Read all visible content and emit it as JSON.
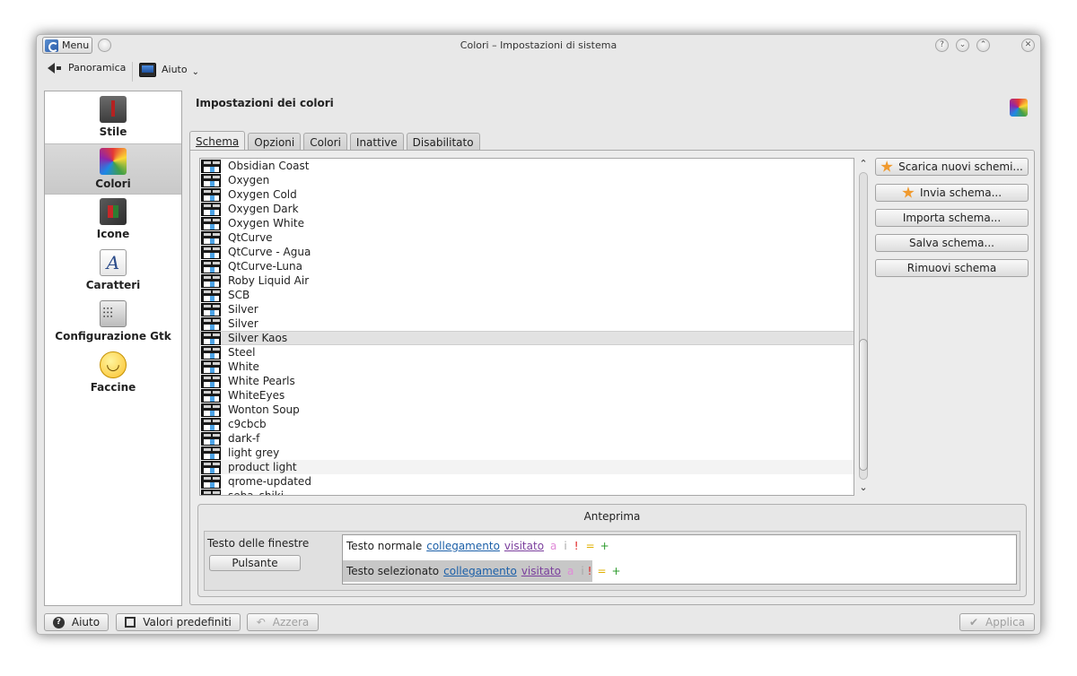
{
  "window": {
    "title": "Colori – Impostazioni di sistema",
    "menu_label": "Menu",
    "title_buttons": [
      "?",
      "⌄",
      "⌃",
      "✕"
    ]
  },
  "toolbar": {
    "overview_label": "Panoramica",
    "help_label": "Aiuto"
  },
  "sidebar": {
    "items": [
      {
        "label": "Stile",
        "icon": "tie-suit-icon"
      },
      {
        "label": "Colori",
        "icon": "color-wheel-icon"
      },
      {
        "label": "Icone",
        "icon": "icons-box-icon"
      },
      {
        "label": "Caratteri",
        "icon": "font-letter-icon"
      },
      {
        "label": "Configurazione Gtk",
        "icon": "sliders-icon"
      },
      {
        "label": "Faccine",
        "icon": "smiley-icon"
      }
    ]
  },
  "main": {
    "title": "Impostazioni dei colori",
    "tabs": [
      "Schema",
      "Opzioni",
      "Colori",
      "Inattive",
      "Disabilitato"
    ]
  },
  "scheme_list": {
    "items": [
      "Obsidian Coast",
      "Oxygen",
      "Oxygen Cold",
      "Oxygen Dark",
      "Oxygen White",
      "QtCurve",
      "QtCurve - Agua",
      "QtCurve-Luna",
      "Roby Liquid Air",
      "SCB",
      "Silver",
      "Silver",
      "Silver Kaos",
      "Steel",
      "White",
      "White Pearls",
      "WhiteEyes",
      "Wonton Soup",
      "c9cbcb",
      "dark-f",
      "light grey",
      "product light",
      "qrome-updated",
      "seba_shiki"
    ],
    "selected": "Silver Kaos",
    "hovered": "product light",
    "scroll_up": "⌃",
    "scroll_down": "⌄"
  },
  "actions": {
    "download": "Scarica nuovi schemi...",
    "upload": "Invia schema...",
    "import": "Importa schema...",
    "save": "Salva schema...",
    "remove": "Rimuovi schema"
  },
  "preview": {
    "title": "Anteprima",
    "window_text_label": "Testo delle finestre",
    "button_label": "Pulsante",
    "normal_text": "Testo normale",
    "selected_text": "Testo selezionato",
    "link": "collegamento",
    "visited": "visitato",
    "symbols": [
      "a",
      "i",
      "!",
      "=",
      "+"
    ]
  },
  "footer": {
    "help": "Aiuto",
    "defaults": "Valori predefiniti",
    "reset": "Azzera",
    "apply": "Applica"
  },
  "colors": {
    "link": "#1b5fa8",
    "visited": "#7b3f9d",
    "sym_a": "#e08ad8",
    "sym_i": "#a7a7a7",
    "sym_bang": "#e02020",
    "sym_eq": "#e0b000",
    "sym_plus": "#2a9a2a"
  }
}
